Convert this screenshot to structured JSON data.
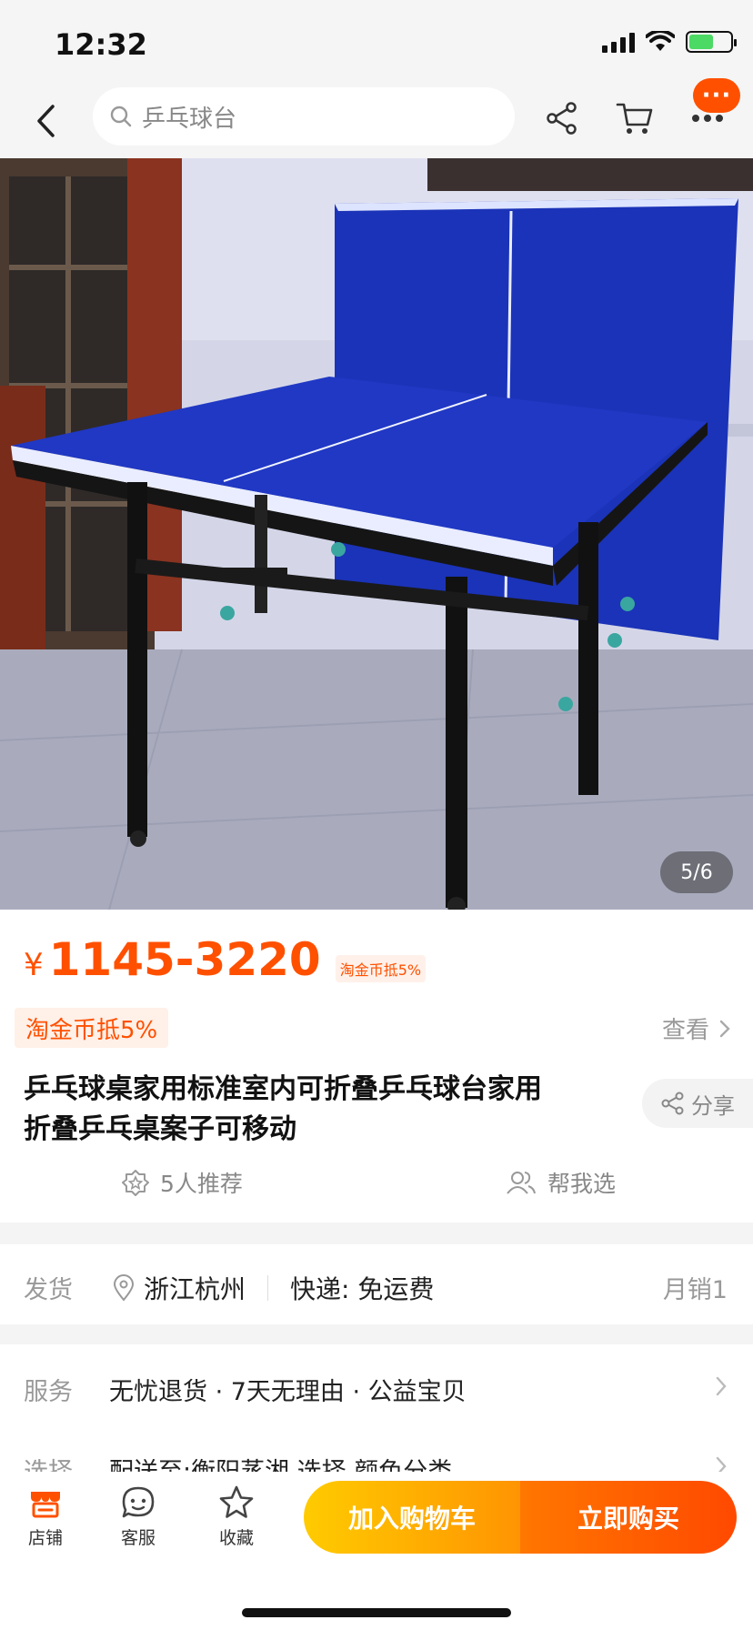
{
  "status_bar": {
    "time": "12:32"
  },
  "nav": {
    "search_placeholder": "乒乓球台",
    "more_badge": "···",
    "icons": [
      "back-icon",
      "search-icon",
      "share-icon",
      "cart-icon",
      "more-icon"
    ]
  },
  "gallery": {
    "counter": "5/6"
  },
  "price": {
    "currency": "¥",
    "range": "1145-3220",
    "tag": "淘金币抵5%"
  },
  "promo": {
    "coin_badge": "淘金币抵5%",
    "view_label": "查看"
  },
  "product": {
    "title_line1": "乒乓球桌家用标准室内可折叠乒乓球台家用",
    "title_line2": "折叠乒乓桌案子可移动",
    "share_label": "分享"
  },
  "recommend": {
    "count_label": "5人推荐",
    "help_label": "帮我选"
  },
  "shipping": {
    "label": "发货",
    "location": "浙江杭州",
    "delivery": "快递: 免运费",
    "monthly_sales": "月销1"
  },
  "service": {
    "label": "服务",
    "text": "无忧退货 · 7天无理由 · 公益宝贝",
    "select_label": "选择",
    "select_text": "配送至:衡阳蒸湘 选择 颜色分类"
  },
  "bottom_bar": {
    "store": "店铺",
    "support": "客服",
    "favorite": "收藏",
    "add_to_cart": "加入购物车",
    "buy_now": "立即购买"
  },
  "colors": {
    "accent": "#ff5000",
    "cart_button": "#ffb000",
    "buy_button": "#ff5a00",
    "table_blue": "#1b33b8"
  }
}
